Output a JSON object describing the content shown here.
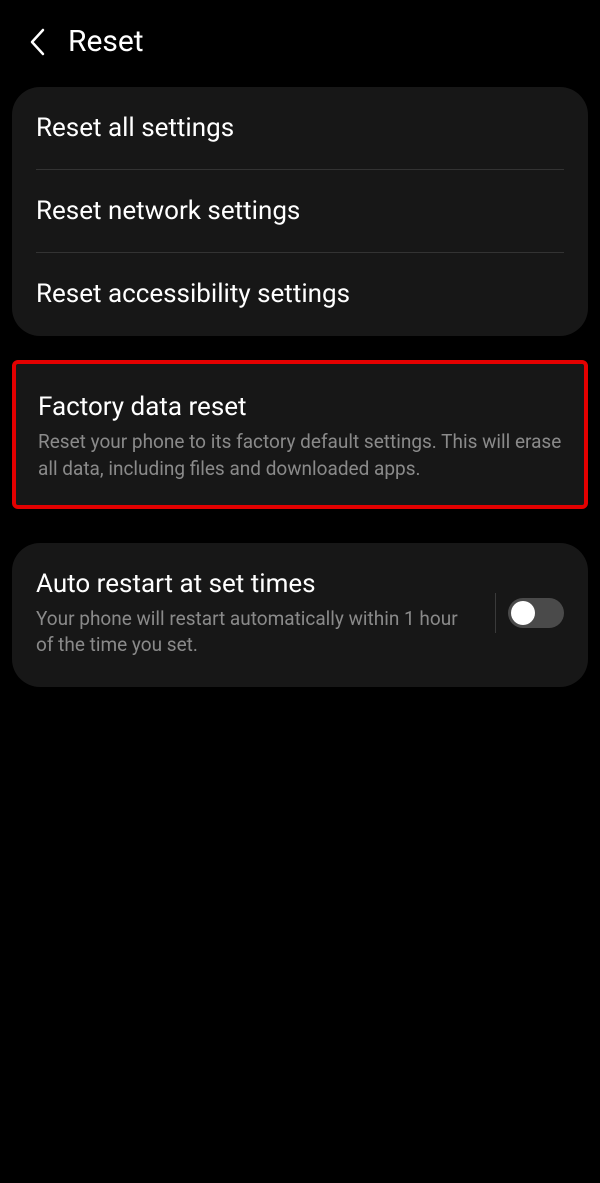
{
  "header": {
    "title": "Reset"
  },
  "group1": {
    "items": [
      {
        "title": "Reset all settings"
      },
      {
        "title": "Reset network settings"
      },
      {
        "title": "Reset accessibility settings"
      }
    ]
  },
  "factory": {
    "title": "Factory data reset",
    "subtitle": "Reset your phone to its factory default settings. This will erase all data, including files and downloaded apps."
  },
  "auto_restart": {
    "title": "Auto restart at set times",
    "subtitle": "Your phone will restart automatically within 1 hour of the time you set.",
    "toggle_on": false
  },
  "colors": {
    "highlight_border": "#e30000",
    "card_bg": "#171717",
    "subtitle": "#8a8a8a"
  }
}
